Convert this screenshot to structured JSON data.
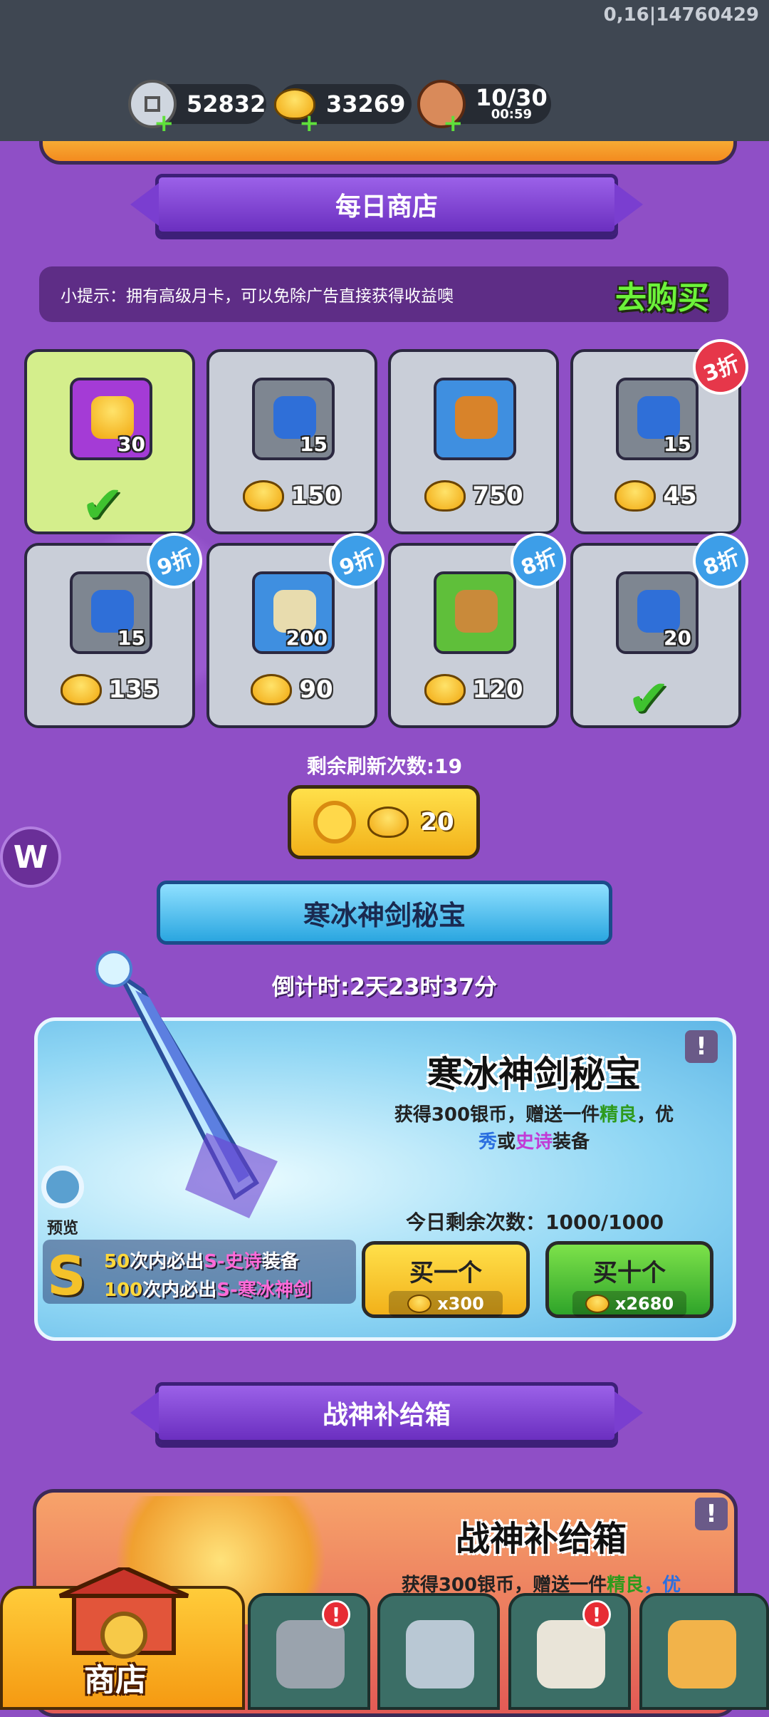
{
  "status": {
    "id_text": "0,16|14760429"
  },
  "resources": [
    {
      "icon": "silver-coin-icon",
      "value": "52832"
    },
    {
      "icon": "gold-ingot-icon",
      "value": "33269"
    },
    {
      "icon": "meat-icon",
      "value": "10/30",
      "timer": "00:59"
    }
  ],
  "daily_shop": {
    "title": "每日商店",
    "tip": "小提示：拥有高级月卡，可以免除广告直接获得收益噢",
    "go_buy": "去购买",
    "items": [
      {
        "icon": "gold-ingot-icon",
        "color": "purple",
        "qty": "30",
        "price": "",
        "purchased": true,
        "discount": ""
      },
      {
        "icon": "blue-helmet-gem-icon",
        "color": "gray",
        "qty": "15",
        "price": "150",
        "purchased": false,
        "discount": ""
      },
      {
        "icon": "weapon-icon",
        "color": "blue",
        "qty": "",
        "price": "750",
        "purchased": false,
        "discount": ""
      },
      {
        "icon": "blue-armor-gem-icon",
        "color": "gray",
        "qty": "15",
        "price": "45",
        "purchased": false,
        "discount": "3折"
      },
      {
        "icon": "blue-armor-gem-icon",
        "color": "gray",
        "qty": "15",
        "price": "135",
        "purchased": false,
        "discount": "9折"
      },
      {
        "icon": "scroll-icon",
        "color": "blue",
        "qty": "200",
        "price": "90",
        "purchased": false,
        "discount": "9折"
      },
      {
        "icon": "boots-icon",
        "color": "green",
        "qty": "",
        "price": "120",
        "purchased": false,
        "discount": "8折"
      },
      {
        "icon": "blue-helmet-gem-icon",
        "color": "gray",
        "qty": "20",
        "price": "",
        "purchased": true,
        "discount": "8折"
      }
    ],
    "refresh_label": "剩余刷新次数:19",
    "refresh_cost": "20"
  },
  "ice_treasure": {
    "banner": "寒冰神剑秘宝",
    "countdown": "倒计时:2天23时37分",
    "title": "寒冰神剑秘宝",
    "desc_pre": "获得300银币，赠送一件",
    "desc_good": "精良",
    "desc_sep1": "，优",
    "desc_ex": "秀",
    "desc_or": "或",
    "desc_epic": "史诗",
    "desc_post": "装备",
    "remaining": "今日剩余次数：1000/1000",
    "buy_one": "买一个",
    "buy_one_cost": "x300",
    "buy_ten": "买十个",
    "buy_ten_cost": "x2680",
    "preview": "预览",
    "guarantee1_num": "50",
    "guarantee1_mid": "次内必出",
    "guarantee1_item": "S-史诗",
    "guarantee1_end": "装备",
    "guarantee2_num": "100",
    "guarantee2_mid": "次内必出",
    "guarantee2_item": "S-寒冰神剑",
    "info": "!"
  },
  "war_supply": {
    "banner": "战神补给箱",
    "title": "战神补给箱",
    "desc_pre": "获得300银币，赠送一件",
    "desc_good": "精良",
    "desc_sep1": "，优",
    "info": "!"
  },
  "nav": {
    "shop": "商店",
    "tabs": [
      {
        "icon": "helmet-icon",
        "badge": "!"
      },
      {
        "icon": "sword-shield-icon",
        "badge": ""
      },
      {
        "icon": "rooster-icon",
        "badge": "!"
      },
      {
        "icon": "fist-upgrade-icon",
        "badge": ""
      }
    ]
  },
  "logo": "W"
}
